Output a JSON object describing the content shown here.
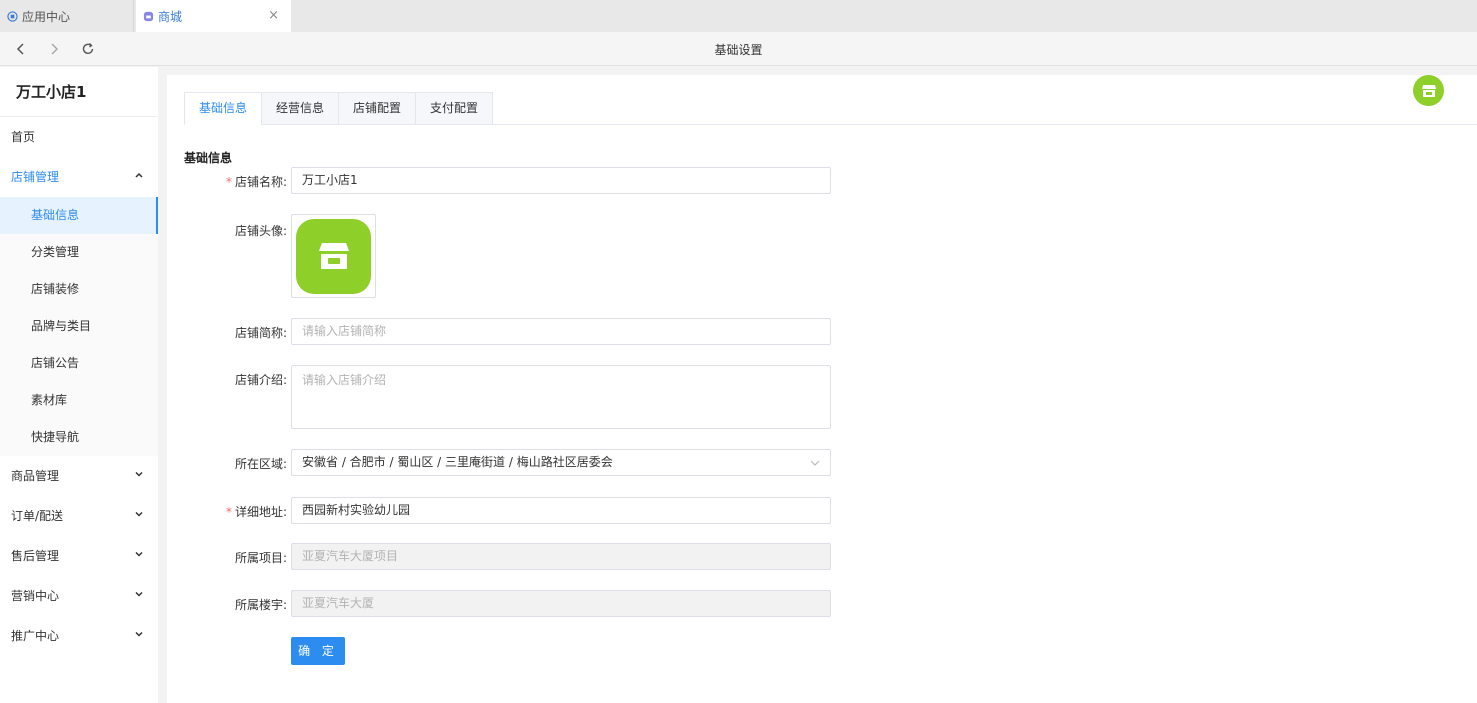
{
  "browser": {
    "tabs": [
      {
        "label": "应用中心"
      },
      {
        "label": "商城"
      }
    ],
    "close_glyph": "×",
    "page_title": "基础设置"
  },
  "sidebar": {
    "shop_name": "万工小店1",
    "home": "首页",
    "store_mgmt": "店铺管理",
    "sub_items": [
      "基础信息",
      "分类管理",
      "店铺装修",
      "品牌与类目",
      "店铺公告",
      "素材库",
      "快捷导航"
    ],
    "groups": [
      "商品管理",
      "订单/配送",
      "售后管理",
      "营销中心",
      "推广中心"
    ]
  },
  "content_tabs": [
    "基础信息",
    "经营信息",
    "店铺配置",
    "支付配置"
  ],
  "form": {
    "section_title": "基础信息",
    "store_name": {
      "label": "店铺名称:",
      "value": "万工小店1",
      "required": true
    },
    "avatar": {
      "label": "店铺头像:"
    },
    "short_name": {
      "label": "店铺简称:",
      "placeholder": "请输入店铺简称"
    },
    "intro": {
      "label": "店铺介绍:",
      "placeholder": "请输入店铺介绍"
    },
    "region": {
      "label": "所在区域:",
      "value": "安徽省 / 合肥市 / 蜀山区 / 三里庵街道 / 梅山路社区居委会"
    },
    "address": {
      "label": "详细地址:",
      "value": "西园新村实验幼儿园",
      "required": true
    },
    "project": {
      "label": "所属项目:",
      "value": "亚夏汽车大厦项目"
    },
    "building": {
      "label": "所属楼宇:",
      "value": "亚夏汽车大厦"
    },
    "submit": "确 定"
  },
  "colors": {
    "accent": "#2d8cf0",
    "store_green": "#8fcf2a",
    "required": "#f56c6c"
  },
  "icons": {
    "store": "store-icon",
    "back": "back-icon",
    "forward": "forward-icon",
    "refresh": "refresh-icon"
  }
}
